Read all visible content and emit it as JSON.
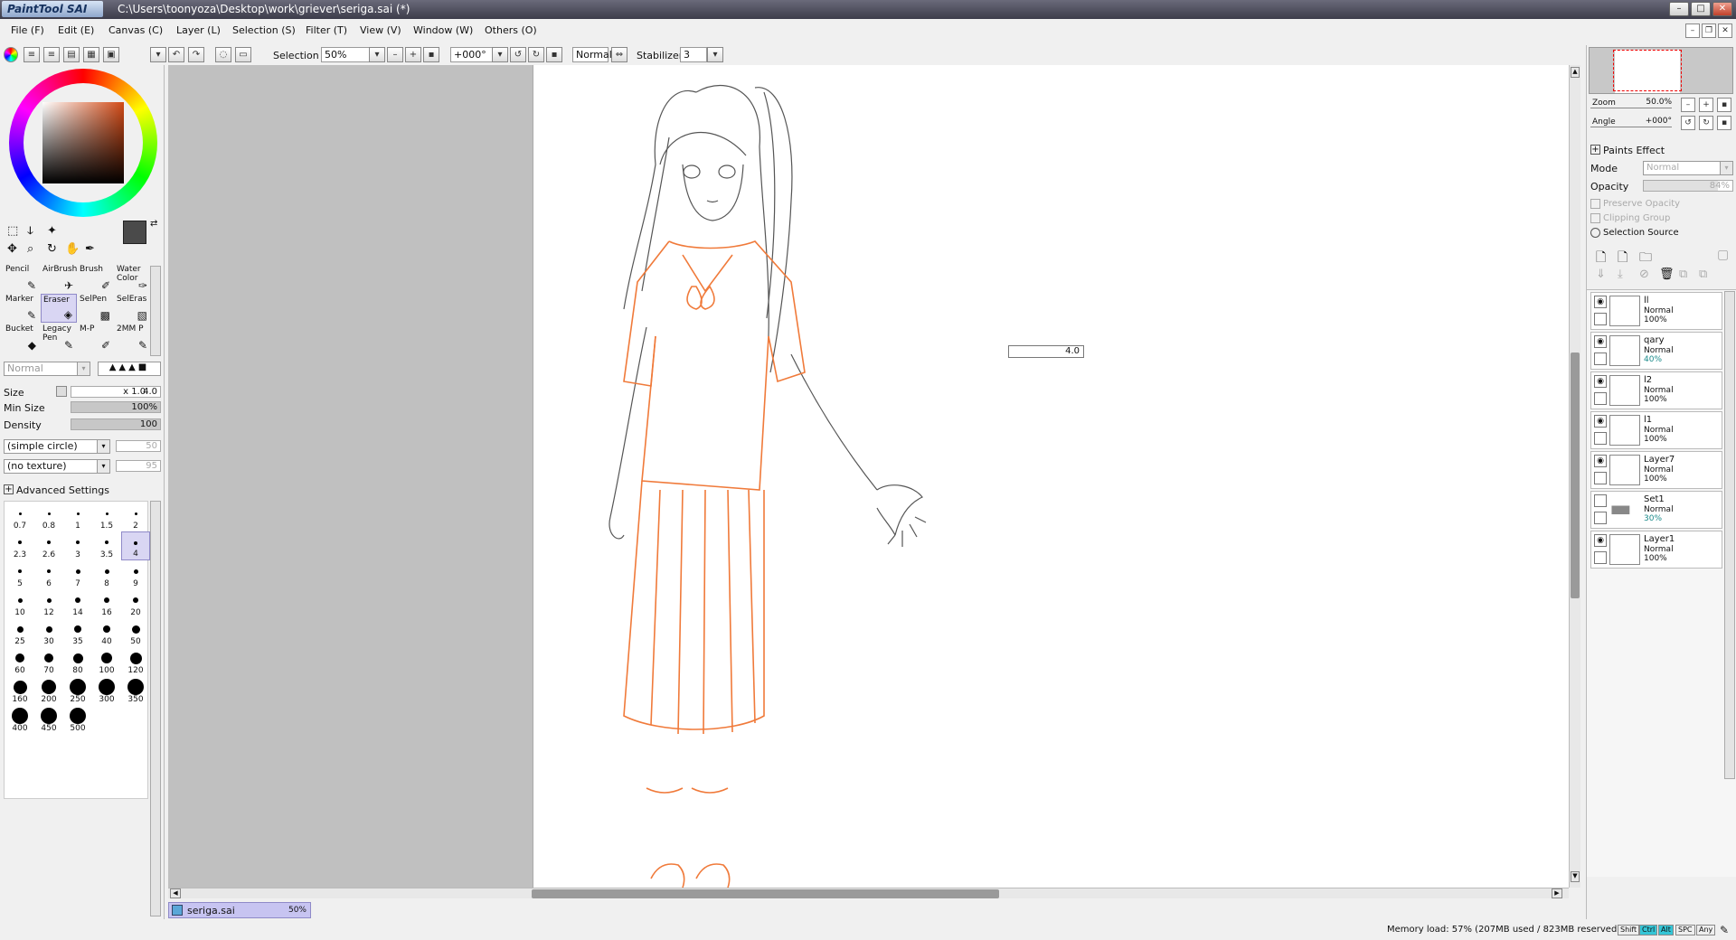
{
  "window": {
    "app_logo": "PaintTool SAI",
    "title_path": "C:\\Users\\toonyoza\\Desktop\\work\\griever\\seriga.sai (*)"
  },
  "menu": {
    "items": [
      "File (F)",
      "Edit (E)",
      "Canvas (C)",
      "Layer (L)",
      "Selection (S)",
      "Filter (T)",
      "View (V)",
      "Window (W)",
      "Others (O)"
    ]
  },
  "toolbar": {
    "selection_label": "Selection",
    "selection_checked": true,
    "zoom_value": "50%",
    "rotation_value": "+000°",
    "blend_mode": "Normal",
    "stabilizer_label": "Stabilizer",
    "stabilizer_value": "3"
  },
  "tools": {
    "items": [
      {
        "label": "Pencil",
        "icon": "pencil-icon"
      },
      {
        "label": "AirBrush",
        "icon": "airbrush-icon"
      },
      {
        "label": "Brush",
        "icon": "brush-icon"
      },
      {
        "label": "Water Color",
        "icon": "watercolor-icon"
      },
      {
        "label": "Marker",
        "icon": "marker-icon"
      },
      {
        "label": "Eraser",
        "icon": "eraser-icon",
        "selected": true
      },
      {
        "label": "SelPen",
        "icon": "selpen-icon"
      },
      {
        "label": "SelEras",
        "icon": "seleras-icon"
      },
      {
        "label": "Bucket",
        "icon": "bucket-icon"
      },
      {
        "label": "Legacy Pen",
        "icon": "legacy-pen-icon"
      },
      {
        "label": "M-P",
        "icon": "mp-icon"
      },
      {
        "label": "2MM P",
        "icon": "2mm-icon"
      }
    ]
  },
  "brush": {
    "mode": "Normal",
    "size_label": "Size",
    "size_mult": "x 1.0",
    "size_value": "4.0",
    "min_size_label": "Min Size",
    "min_size_value": "100%",
    "density_label": "Density",
    "density_value": "100",
    "shape": "(simple circle)",
    "shape_value": "50",
    "texture": "(no texture)",
    "texture_value": "95",
    "advanced_label": "Advanced Settings",
    "sizes": [
      "0.7",
      "0.8",
      "1",
      "1.5",
      "2",
      "2.3",
      "2.6",
      "3",
      "3.5",
      "4",
      "5",
      "6",
      "7",
      "8",
      "9",
      "10",
      "12",
      "14",
      "16",
      "20",
      "25",
      "30",
      "35",
      "40",
      "50",
      "60",
      "70",
      "80",
      "100",
      "120",
      "160",
      "200",
      "250",
      "300",
      "350",
      "400",
      "450",
      "500"
    ],
    "selected_size": "4"
  },
  "canvas": {
    "size_popup_value": "4.0",
    "tab_name": "seriga.sai",
    "tab_zoom": "50%"
  },
  "navigator": {
    "zoom_label": "Zoom",
    "zoom_value": "50.0%",
    "angle_label": "Angle",
    "angle_value": "+000°"
  },
  "layer_panel": {
    "paints_effect": "Paints Effect",
    "mode_label": "Mode",
    "mode_value": "Normal",
    "opacity_label": "Opacity",
    "opacity_value": "84%",
    "preserve_opacity": "Preserve Opacity",
    "clipping_group": "Clipping Group",
    "selection_source": "Selection Source",
    "layers": [
      {
        "name": "ll",
        "mode": "Normal",
        "opacity": "100%",
        "visible": true,
        "folder": false
      },
      {
        "name": "qary",
        "mode": "Normal",
        "opacity": "40%",
        "visible": true,
        "folder": false
      },
      {
        "name": "l2",
        "mode": "Normal",
        "opacity": "100%",
        "visible": true,
        "folder": false
      },
      {
        "name": "l1",
        "mode": "Normal",
        "opacity": "100%",
        "visible": true,
        "folder": false
      },
      {
        "name": "Layer7",
        "mode": "Normal",
        "opacity": "100%",
        "visible": true,
        "folder": false
      },
      {
        "name": "Set1",
        "mode": "Normal",
        "opacity": "30%",
        "visible": false,
        "folder": true
      },
      {
        "name": "Layer1",
        "mode": "Normal",
        "opacity": "100%",
        "visible": true,
        "folder": false
      }
    ]
  },
  "status": {
    "memory": "Memory load: 57% (207MB used / 823MB reserved)",
    "keys": [
      {
        "label": "Shift",
        "on": false
      },
      {
        "label": "Ctrl",
        "on": true
      },
      {
        "label": "Alt",
        "on": true
      },
      {
        "label": "SPC",
        "on": false
      },
      {
        "label": "Any",
        "on": false
      }
    ]
  },
  "colors": {
    "sketch_orange": "#f07a3a",
    "line_gray": "#555555",
    "selection_purple": "#d9d6f3"
  }
}
